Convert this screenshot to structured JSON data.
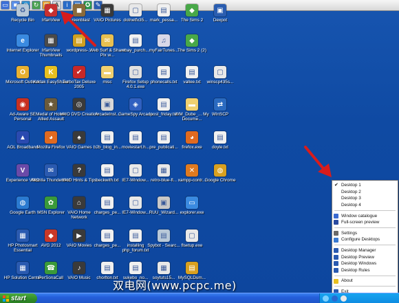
{
  "toolbar": {
    "buttons": [
      {
        "icon": "monitor-icon",
        "color": "#3c6fd8",
        "glyph": "▭"
      },
      {
        "icon": "square-icon",
        "color": "#5a8ee8",
        "glyph": "■"
      },
      {
        "icon": "globe-icon",
        "color": "#2c8fd0",
        "glyph": "◍"
      },
      {
        "icon": "refresh-icon",
        "color": "#4aa050",
        "glyph": "↻"
      },
      {
        "icon": "windows-logo-icon",
        "color": "#e8a030",
        "glyph": "⊞"
      },
      {
        "icon": "font-icon",
        "color": "#d9d9d9",
        "glyph": "A"
      },
      {
        "icon": "info-icon",
        "color": "#2a6cc8",
        "glyph": "i"
      },
      {
        "icon": "book-icon",
        "color": "#3a78c8",
        "glyph": "▤"
      },
      {
        "icon": "gear-icon",
        "color": "#2a9a4a",
        "glyph": "✪"
      },
      {
        "icon": "edit-icon",
        "color": "#2a5db0",
        "glyph": "✎"
      }
    ]
  },
  "desktop": {
    "icons": [
      {
        "label": "Recycle Bin",
        "icon": "recycle-bin-icon",
        "color": "#b8c8d8",
        "glyph": "♻"
      },
      {
        "label": "IrfanView",
        "icon": "irfanview-icon",
        "color": "#c83030",
        "glyph": "◆"
      },
      {
        "label": "...reenblast",
        "icon": "app-icon",
        "color": "#8a6a3a",
        "glyph": "◼"
      },
      {
        "label": "VAIO Pictures",
        "icon": "vaio-pictures-icon",
        "color": "#3a3a3a",
        "glyph": "▦"
      },
      {
        "label": "dotnetfx35...",
        "icon": "installer-icon",
        "color": "#e8e8e8",
        "glyph": "▢"
      },
      {
        "label": "mark_pessa...",
        "icon": "file-icon",
        "color": "#f0f0f0",
        "glyph": "▤"
      },
      {
        "label": "The Sims 2",
        "icon": "sims-icon",
        "color": "#48a848",
        "glyph": "◆"
      },
      {
        "label": "Dexpot",
        "icon": "dexpot-icon",
        "color": "#2a5db0",
        "glyph": "▣"
      },
      {
        "label": "Internet Explorer",
        "icon": "internet-explorer-icon",
        "color": "#3a8ae0",
        "glyph": "e"
      },
      {
        "label": "IrfanView Thumbnails",
        "icon": "irfanview-thumbnails-icon",
        "color": "#4a4a4a",
        "glyph": "▦"
      },
      {
        "label": "wordpress-...",
        "icon": "zip-icon",
        "color": "#d0a020",
        "glyph": "▤"
      },
      {
        "label": "Web Surf & Share Pix w...",
        "icon": "web-surf-icon",
        "color": "#e8c050",
        "glyph": "✉"
      },
      {
        "label": "ebay_purch...",
        "icon": "html-file-icon",
        "color": "#f0f0f0",
        "glyph": "▤"
      },
      {
        "label": "myFairTunes...",
        "icon": "myfairtunes-icon",
        "color": "#d8d8e8",
        "glyph": "♫"
      },
      {
        "label": "The Sims 2 (2)",
        "icon": "sims-2-icon",
        "color": "#48a848",
        "glyph": "◆"
      },
      {
        "label": "Microsoft Outlook",
        "icon": "outlook-icon",
        "color": "#e8b030",
        "glyph": "O"
      },
      {
        "label": "Kodak EasyShare",
        "icon": "kodak-icon",
        "color": "#e8c020",
        "glyph": "K"
      },
      {
        "label": "TurboTax Deluxe 2005",
        "icon": "turbotax-icon",
        "color": "#c82828",
        "glyph": "✔"
      },
      {
        "label": "misc",
        "icon": "folder-icon",
        "color": "#f0d070",
        "glyph": "▬"
      },
      {
        "label": "Firefox Setup 4.0.1.exe",
        "icon": "firefox-setup-icon",
        "color": "#e0e0e0",
        "glyph": "▢"
      },
      {
        "label": "phonecalls.txt",
        "icon": "text-file-icon",
        "color": "#f0f0f0",
        "glyph": "▤"
      },
      {
        "label": "vallee.txt",
        "icon": "text-file-icon",
        "color": "#f0f0f0",
        "glyph": "▤"
      },
      {
        "label": "winscp435s...",
        "icon": "installer-icon",
        "color": "#e8e8e8",
        "glyph": "▢"
      },
      {
        "label": "Ad-Aware SE Personal",
        "icon": "ad-aware-icon",
        "color": "#c83020",
        "glyph": "◉"
      },
      {
        "label": "Medal of Honor Allied Assault",
        "icon": "medal-of-honor-icon",
        "color": "#6a5a3a",
        "glyph": "★"
      },
      {
        "label": "VAIO DVD Creation",
        "icon": "vaio-dvd-icon",
        "color": "#3a3a3a",
        "glyph": "◎"
      },
      {
        "label": "ArcadeInst...",
        "icon": "arcade-installer-icon",
        "color": "#d8d8d8",
        "glyph": "▣"
      },
      {
        "label": "GameSpy Arcade",
        "icon": "gamespy-icon",
        "color": "#3060c0",
        "glyph": "◈"
      },
      {
        "label": "post_friday.txt",
        "icon": "text-file-icon",
        "color": "#f0f0f0",
        "glyph": "▤"
      },
      {
        "label": "WM_Dube_... My Docume...",
        "icon": "documents-icon",
        "color": "#f0d070",
        "glyph": "▬"
      },
      {
        "label": "WinSCP",
        "icon": "winscp-icon",
        "color": "#2a6ac0",
        "glyph": "⇄"
      },
      {
        "label": "AOL Broadband",
        "icon": "aol-icon",
        "color": "#2a4ab0",
        "glyph": "▲"
      },
      {
        "label": "Mozilla Firefox",
        "icon": "firefox-icon",
        "color": "#e06a20",
        "glyph": "◕"
      },
      {
        "label": "VAIO Games",
        "icon": "vaio-games-icon",
        "color": "#3a3a3a",
        "glyph": "♠"
      },
      {
        "label": "b2b_blog_in...",
        "icon": "text-file-icon",
        "color": "#f0f0f0",
        "glyph": "▤"
      },
      {
        "label": "moviestart.h...",
        "icon": "html-file-icon",
        "color": "#f0f0f0",
        "glyph": "▤"
      },
      {
        "label": "pre_publicati...",
        "icon": "text-file-icon",
        "color": "#f0f0f0",
        "glyph": "▤"
      },
      {
        "label": "firefox.exe",
        "icon": "firefox-exe-icon",
        "color": "#e06a20",
        "glyph": "◕"
      },
      {
        "label": "doyle.txt",
        "icon": "text-file-icon",
        "color": "#f0f0f0",
        "glyph": "▤"
      },
      {
        "label": "Experience VAIO",
        "icon": "experience-vaio-icon",
        "color": "#6a4aa8",
        "glyph": "V"
      },
      {
        "label": "Mozilla Thunderbird",
        "icon": "thunderbird-icon",
        "color": "#2a5ab0",
        "glyph": "✉"
      },
      {
        "label": "VAIO Hints & Tips",
        "icon": "vaio-hints-icon",
        "color": "#3a3a3a",
        "glyph": "?"
      },
      {
        "label": "beckwith.txt",
        "icon": "text-file-icon",
        "color": "#f0f0f0",
        "glyph": "▤"
      },
      {
        "label": "IE7-Window...",
        "icon": "installer-icon",
        "color": "#e8e8e8",
        "glyph": "▢"
      },
      {
        "label": "retro-blue-fl...",
        "icon": "image-file-icon",
        "color": "#e8e8e8",
        "glyph": "▦"
      },
      {
        "label": "xampp-contr...",
        "icon": "xampp-icon",
        "color": "#e07a20",
        "glyph": "✕"
      },
      {
        "label": "Google Chrome",
        "icon": "chrome-icon",
        "color": "#d8a020",
        "glyph": "◍"
      },
      {
        "label": "Google Earth",
        "icon": "google-earth-icon",
        "color": "#2a7ad0",
        "glyph": "◍"
      },
      {
        "label": "MSN Explorer",
        "icon": "msn-icon",
        "color": "#3a9a3a",
        "glyph": "✿"
      },
      {
        "label": "VAIO Home Network",
        "icon": "vaio-home-network-icon",
        "color": "#3a3a3a",
        "glyph": "⌂"
      },
      {
        "label": "charges_pe...",
        "icon": "text-file-icon",
        "color": "#f0f0f0",
        "glyph": "▤"
      },
      {
        "label": "IE7-Window...",
        "icon": "installer-icon",
        "color": "#e8e8e8",
        "glyph": "▢"
      },
      {
        "label": "RUU_Wizard...",
        "icon": "ruu-wizard-icon",
        "color": "#c8c8c8",
        "glyph": "▣"
      },
      {
        "label": "explorer.exe",
        "icon": "explorer-exe-icon",
        "color": "#3a8ae0",
        "glyph": "▭"
      },
      {
        "label": "HP Photosmart Essential",
        "icon": "hp-photosmart-icon",
        "color": "#2a5ab0",
        "glyph": "▦"
      },
      {
        "label": "AVG 2012",
        "icon": "avg-icon",
        "color": "#c83828",
        "glyph": "◆"
      },
      {
        "label": "VAIO Movies",
        "icon": "vaio-movies-icon",
        "color": "#3a3a3a",
        "glyph": "▶"
      },
      {
        "label": "charges_pe...",
        "icon": "text-file-icon",
        "color": "#f0f0f0",
        "glyph": "▤"
      },
      {
        "label": "installing php_forum.txt",
        "icon": "text-file-icon",
        "color": "#f0f0f0",
        "glyph": "▤"
      },
      {
        "label": "Spybot - Searc...",
        "icon": "spybot-icon",
        "color": "#b8c8d8",
        "glyph": "▤"
      },
      {
        "label": "flsetup.exe",
        "icon": "installer-icon",
        "color": "#e8e8e8",
        "glyph": "▢"
      },
      {
        "label": "HP Solution Center",
        "icon": "hp-solution-center-icon",
        "color": "#2a5ab0",
        "glyph": "▦"
      },
      {
        "label": "PerSonaCall",
        "icon": "personacall-icon",
        "color": "#3a9a3a",
        "glyph": "☎"
      },
      {
        "label": "VAIO Music",
        "icon": "vaio-music-icon",
        "color": "#3a3a3a",
        "glyph": "♪"
      },
      {
        "label": "chorlton.txt",
        "icon": "text-file-icon",
        "color": "#f0f0f0",
        "glyph": "▤"
      },
      {
        "label": "sukebo_no...",
        "icon": "text-file-icon",
        "color": "#f0f0f0",
        "glyph": "▤"
      },
      {
        "label": "soytuts15...",
        "icon": "image-file-icon",
        "color": "#e8e8e8",
        "glyph": "▦"
      },
      {
        "label": "MySQLDum...",
        "icon": "mysqldump-icon",
        "color": "#d8a020",
        "glyph": "▤"
      }
    ]
  },
  "context_menu": {
    "groups": [
      [
        {
          "label": "Desktop 1",
          "checked": true
        },
        {
          "label": "Desktop 2",
          "checked": false
        },
        {
          "label": "Desktop 3",
          "checked": false
        },
        {
          "label": "Desktop 4",
          "checked": false
        }
      ],
      [
        {
          "label": "Window catalogue",
          "icon": "window-catalogue-icon",
          "color": "#3a6ad0"
        },
        {
          "label": "Full-screen preview",
          "icon": "full-screen-preview-icon",
          "color": "#2a4aa0"
        }
      ],
      [
        {
          "label": "Settings",
          "icon": "settings-icon",
          "color": "#6a6a6a"
        },
        {
          "label": "Configure Desktops",
          "icon": "configure-desktops-icon",
          "color": "#3a7ad0"
        }
      ],
      [
        {
          "label": "Desktop Manager",
          "icon": "desktop-manager-icon",
          "color": "#2a5ab0"
        },
        {
          "label": "Desktop Preview",
          "icon": "desktop-preview-icon",
          "color": "#2a5ab0"
        },
        {
          "label": "Desktop Windows",
          "icon": "desktop-windows-icon",
          "color": "#2a5ab0"
        },
        {
          "label": "Desktop Rules",
          "icon": "desktop-rules-icon",
          "color": "#2a5ab0"
        }
      ],
      [
        {
          "label": "About",
          "icon": "about-icon",
          "color": "#e8c020"
        }
      ],
      [
        {
          "label": "Exit",
          "icon": "exit-icon",
          "color": "#2a5ab0"
        }
      ]
    ]
  },
  "taskbar": {
    "start_label": "start",
    "tray_icons": [
      {
        "icon": "network-icon",
        "color": "#7ad0ff"
      },
      {
        "icon": "dexpot-tray-icon",
        "color": "#2a6ad0"
      },
      {
        "icon": "volume-icon",
        "color": "#e8e8e8"
      }
    ]
  },
  "watermark": "双电网(www.pcpc.me)",
  "annotations": {
    "arrow_color": "#d81c1c"
  }
}
